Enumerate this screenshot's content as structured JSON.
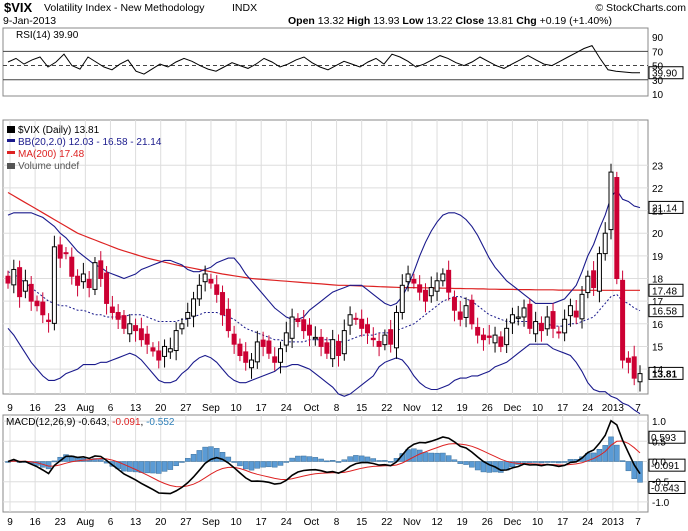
{
  "header": {
    "symbol": "$VIX",
    "name": "Volatility Index - New Methodology",
    "exchange": "INDX",
    "brand": "© StockCharts.com",
    "date": "9-Jan-2013",
    "open_label": "Open",
    "open": "13.32",
    "high_label": "High",
    "high": "13.93",
    "low_label": "Low",
    "low": "13.22",
    "close_label": "Close",
    "close": "13.81",
    "chg_label": "Chg",
    "chg": "+0.19 (+1.40%)"
  },
  "colors": {
    "up": "#000000",
    "down": "#cc0033",
    "bb": "#1a1a8c",
    "ma": "#dd2222",
    "volume_up": "#2f7fb8",
    "volume_down": "#cc0033",
    "macd_hist": "#5b9bd5",
    "macd_signal": "#dd2222",
    "grid": "#dddddd",
    "dashed": "#7777cc"
  },
  "chart_data": [
    {
      "type": "line",
      "title": "RSI(14) 39.90",
      "label": "RSI(14)",
      "current": "39.90",
      "ylim": [
        10,
        100
      ],
      "y_ticks": [
        "90",
        "70",
        "50",
        "30",
        "10"
      ],
      "reference_lines": [
        70,
        30
      ],
      "center_line": 50,
      "values": [
        55,
        60,
        52,
        58,
        62,
        48,
        55,
        66,
        50,
        45,
        62,
        55,
        48,
        44,
        52,
        58,
        42,
        38,
        45,
        52,
        48,
        55,
        60,
        56,
        50,
        45,
        42,
        48,
        54,
        50,
        46,
        52,
        60,
        55,
        48,
        52,
        58,
        62,
        54,
        48,
        44,
        50,
        56,
        52,
        48,
        55,
        60,
        52,
        66,
        62,
        56,
        48,
        52,
        58,
        64,
        60,
        54,
        50,
        55,
        62,
        56,
        50,
        46,
        52,
        58,
        64,
        58,
        52,
        50,
        56,
        62,
        68,
        74,
        78,
        60,
        44,
        42,
        41,
        40,
        40
      ]
    },
    {
      "type": "candlestick",
      "title": "$VIX (Daily) 13.81",
      "ylim": [
        12.9,
        25
      ],
      "y_ticks": [
        23,
        22,
        21,
        20,
        19,
        18,
        17,
        16,
        15,
        14
      ],
      "legend": [
        {
          "label": "$VIX (Daily) 13.81",
          "color": "#000000"
        },
        {
          "label": "BB(20,2.0) 12.03 - 16.58 - 21.14",
          "color": "#1a1a8c"
        },
        {
          "label": "MA(200) 17.48",
          "color": "#dd2222"
        },
        {
          "label": "Volume undef",
          "color": "#555555"
        }
      ],
      "right_labels": [
        {
          "value": 21.14,
          "text": "21.14"
        },
        {
          "value": 17.48,
          "text": "17.48"
        },
        {
          "value": 16.58,
          "text": "16.58"
        },
        {
          "value": 13.81,
          "text": "13.81"
        }
      ],
      "x_tick_labels": [
        "9",
        "16",
        "23",
        "Aug",
        "6",
        "13",
        "20",
        "27",
        "Sep",
        "10",
        "17",
        "24",
        "Oct",
        "8",
        "15",
        "22",
        "Nov",
        "12",
        "19",
        "26",
        "Dec",
        "10",
        "17",
        "24",
        "2013",
        "7"
      ],
      "close": [
        17.8,
        18.4,
        17.2,
        17.9,
        17.0,
        16.8,
        16.4,
        16.1,
        19.4,
        18.9,
        19.1,
        18.1,
        17.7,
        18.2,
        17.6,
        18.7,
        18.0,
        16.9,
        16.5,
        16.2,
        15.8,
        16.0,
        15.7,
        15.3,
        15.1,
        14.8,
        14.4,
        15.0,
        14.9,
        15.7,
        16.0,
        16.5,
        17.1,
        17.7,
        18.2,
        17.8,
        17.3,
        16.4,
        15.7,
        15.1,
        14.6,
        14.3,
        14.4,
        15.2,
        15.0,
        14.7,
        14.3,
        14.9,
        15.6,
        16.3,
        16.1,
        15.7,
        15.5,
        15.4,
        15.0,
        14.7,
        15.3,
        14.6,
        15.7,
        16.4,
        16.2,
        15.8,
        15.6,
        15.3,
        15.0,
        15.5,
        15.1,
        16.5,
        17.7,
        18.2,
        17.8,
        17.4,
        17.0,
        17.6,
        17.9,
        18.2,
        17.4,
        16.6,
        16.2,
        16.8,
        16.0,
        15.5,
        15.3,
        15.4,
        15.5,
        15.0,
        15.8,
        16.4,
        16.3,
        16.7,
        15.8,
        16.1,
        15.7,
        16.3,
        15.8,
        15.6,
        16.2,
        16.8,
        16.3,
        17.3,
        18.1,
        17.6,
        19.1,
        20.0,
        22.7,
        18.0,
        14.4,
        14.3,
        13.6,
        13.8
      ],
      "ma200": [
        21.8,
        21.65,
        21.5,
        21.35,
        21.2,
        21.05,
        20.9,
        20.75,
        20.6,
        20.45,
        20.3,
        20.15,
        20.0,
        19.9,
        19.8,
        19.7,
        19.6,
        19.5,
        19.4,
        19.3,
        19.22,
        19.14,
        19.06,
        18.98,
        18.9,
        18.84,
        18.78,
        18.72,
        18.66,
        18.6,
        18.55,
        18.5,
        18.45,
        18.4,
        18.35,
        18.3,
        18.25,
        18.2,
        18.16,
        18.12,
        18.08,
        18.04,
        18.0,
        17.98,
        17.96,
        17.94,
        17.92,
        17.9,
        17.88,
        17.86,
        17.84,
        17.82,
        17.8,
        17.78,
        17.76,
        17.74,
        17.72,
        17.7,
        17.7,
        17.69,
        17.68,
        17.67,
        17.66,
        17.65,
        17.64,
        17.63,
        17.62,
        17.61,
        17.6,
        17.6,
        17.6,
        17.59,
        17.59,
        17.58,
        17.58,
        17.57,
        17.57,
        17.56,
        17.56,
        17.55,
        17.55,
        17.54,
        17.54,
        17.53,
        17.53,
        17.52,
        17.52,
        17.52,
        17.51,
        17.51,
        17.51,
        17.5,
        17.5,
        17.5,
        17.5,
        17.49,
        17.49,
        17.49,
        17.49,
        17.49,
        17.48,
        17.48,
        17.48,
        17.48,
        17.48,
        17.48,
        17.48,
        17.48,
        17.48,
        17.48
      ],
      "bb_mid": [
        18.3,
        18.2,
        18.0,
        17.8,
        17.6,
        17.4,
        17.2,
        17.0,
        16.9,
        16.8,
        16.8,
        16.7,
        16.6,
        16.6,
        16.5,
        16.4,
        16.4,
        16.3,
        16.3,
        16.3,
        16.3,
        16.4,
        16.4,
        16.4,
        16.3,
        16.2,
        16.1,
        16.1,
        16.1,
        16.1,
        16.2,
        16.2,
        16.3,
        16.4,
        16.5,
        16.5,
        16.5,
        16.4,
        16.3,
        16.2,
        16.0,
        15.8,
        15.7,
        15.6,
        15.5,
        15.4,
        15.3,
        15.3,
        15.2,
        15.2,
        15.2,
        15.2,
        15.3,
        15.3,
        15.3,
        15.3,
        15.3,
        15.2,
        15.2,
        15.3,
        15.4,
        15.5,
        15.5,
        15.5,
        15.6,
        15.6,
        15.6,
        15.7,
        15.8,
        15.9,
        16.0,
        16.2,
        16.4,
        16.6,
        16.8,
        17.0,
        17.1,
        17.2,
        17.2,
        17.1,
        17.0,
        16.8,
        16.6,
        16.4,
        16.3,
        16.2,
        16.1,
        16.1,
        16.1,
        16.1,
        16.1,
        16.0,
        16.0,
        16.0,
        15.9,
        15.9,
        15.9,
        16.0,
        16.0,
        16.1,
        16.2,
        16.3,
        16.6,
        16.9,
        17.2,
        17.3,
        17.0,
        16.9,
        16.7,
        16.58
      ],
      "bb_width": [
        2.5,
        2.7,
        2.9,
        3.1,
        3.3,
        3.4,
        3.5,
        3.5,
        3.4,
        3.2,
        3.0,
        2.8,
        2.6,
        2.4,
        2.3,
        2.2,
        2.1,
        2.0,
        1.9,
        1.8,
        1.7,
        1.7,
        1.8,
        2.0,
        2.2,
        2.4,
        2.6,
        2.7,
        2.7,
        2.6,
        2.4,
        2.2,
        2.0,
        1.9,
        1.9,
        2.0,
        2.2,
        2.4,
        2.6,
        2.7,
        2.6,
        2.4,
        2.2,
        2.0,
        1.8,
        1.6,
        1.4,
        1.2,
        1.1,
        1.0,
        1.0,
        1.1,
        1.3,
        1.5,
        1.7,
        1.9,
        2.1,
        2.3,
        2.4,
        2.4,
        2.3,
        2.2,
        2.0,
        1.8,
        1.5,
        1.3,
        1.2,
        1.2,
        1.4,
        1.8,
        2.3,
        2.8,
        3.2,
        3.5,
        3.7,
        3.8,
        3.8,
        3.7,
        3.6,
        3.5,
        3.3,
        3.1,
        2.8,
        2.5,
        2.2,
        2.0,
        1.8,
        1.6,
        1.4,
        1.2,
        1.0,
        0.9,
        0.9,
        0.9,
        1.0,
        1.1,
        1.2,
        1.4,
        1.7,
        2.2,
        2.8,
        3.2,
        3.6,
        3.9,
        4.4,
        4.6,
        4.5,
        4.5,
        4.5,
        4.55
      ]
    },
    {
      "type": "line",
      "title": "MACD(12,26,9) -0.643, -0.091, -0.552",
      "label": "MACD(12,26,9)",
      "values_text": [
        "-0.643",
        "-0.091",
        "-0.552"
      ],
      "ylim": [
        -1.25,
        1.15
      ],
      "y_ticks": [
        1.0,
        0.5,
        0.0,
        -0.5,
        -1.0
      ],
      "right_labels": [
        {
          "value": 0.6,
          "text": "0.593"
        },
        {
          "value": -0.091,
          "text": "-0.091"
        },
        {
          "value": -0.643,
          "text": "-0.643"
        }
      ],
      "x_tick_labels": [
        "9",
        "16",
        "23",
        "Aug",
        "6",
        "13",
        "20",
        "27",
        "Sep",
        "10",
        "17",
        "24",
        "Oct",
        "8",
        "15",
        "22",
        "Nov",
        "12",
        "19",
        "26",
        "Dec",
        "10",
        "17",
        "24",
        "2013",
        "7"
      ]
    }
  ]
}
